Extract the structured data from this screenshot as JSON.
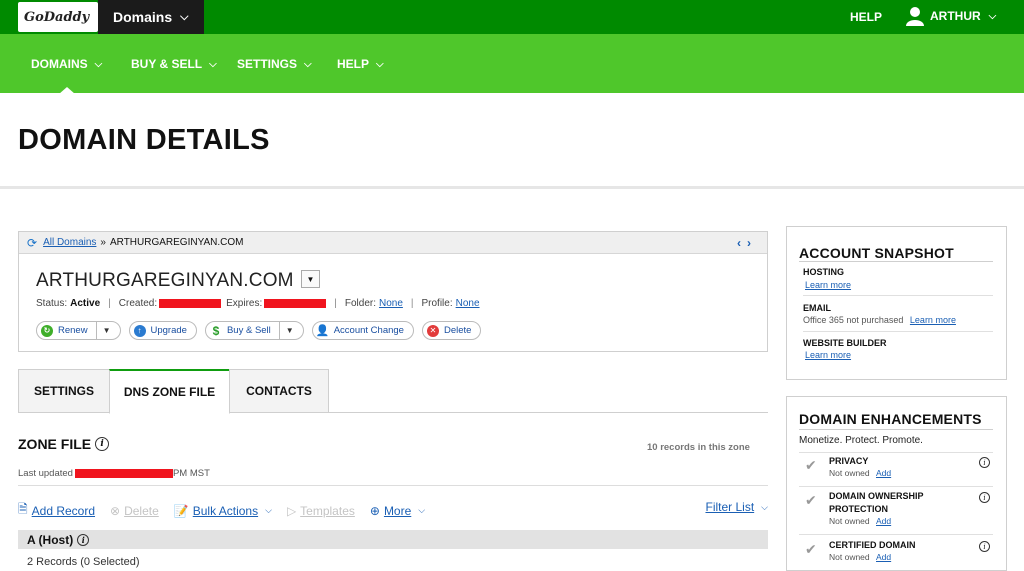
{
  "brand": {
    "logo_text": "GoDaddy",
    "product_switch": "Domains"
  },
  "topbar": {
    "help": "HELP",
    "user": "ARTHUR"
  },
  "nav": {
    "items": [
      {
        "label": "DOMAINS"
      },
      {
        "label": "BUY & SELL"
      },
      {
        "label": "SETTINGS"
      },
      {
        "label": "HELP"
      }
    ]
  },
  "page": {
    "title": "DOMAIN DETAILS"
  },
  "domain_panel": {
    "all_domains": "All Domains",
    "separator": "»",
    "current": "ARTHURGAREGINYAN.COM",
    "name": "ARTHURGAREGINYAN.COM",
    "status_label": "Status:",
    "status_value": "Active",
    "created_label": "Created:",
    "expires_label": "Expires:",
    "folder_label": "Folder:",
    "folder_value": "None",
    "profile_label": "Profile:",
    "profile_value": "None",
    "actions": {
      "renew": "Renew",
      "upgrade": "Upgrade",
      "buy_sell": "Buy & Sell",
      "account_change": "Account Change",
      "delete": "Delete"
    }
  },
  "tabs": [
    {
      "label": "SETTINGS"
    },
    {
      "label": "DNS ZONE FILE"
    },
    {
      "label": "CONTACTS"
    }
  ],
  "zone": {
    "title": "ZONE FILE",
    "count": "10 records in this zone",
    "last_updated_label": "Last updated",
    "last_updated_suffix": "PM MST",
    "toolbar": {
      "add_record": "Add Record",
      "delete": "Delete",
      "bulk_actions": "Bulk Actions",
      "templates": "Templates",
      "more": "More",
      "filter": "Filter List"
    },
    "section": "A (Host)",
    "records": "2 Records (0 Selected)"
  },
  "snapshot": {
    "title": "ACCOUNT SNAPSHOT",
    "hosting_label": "HOSTING",
    "hosting_link": "Learn more",
    "email_label": "EMAIL",
    "email_status": "Office 365 not purchased",
    "email_link": "Learn more",
    "builder_label": "WEBSITE BUILDER",
    "builder_link": "Learn more"
  },
  "enhancements": {
    "title": "DOMAIN ENHANCEMENTS",
    "subtitle": "Monetize. Protect. Promote.",
    "items": [
      {
        "label": "PRIVACY",
        "status": "Not owned",
        "action": "Add"
      },
      {
        "label": "DOMAIN OWNERSHIP PROTECTION",
        "status": "Not owned",
        "action": "Add"
      },
      {
        "label": "CERTIFIED DOMAIN",
        "status": "Not owned",
        "action": "Add"
      }
    ]
  },
  "colors": {
    "top_green": "#008a00",
    "nav_green": "#4fc72b",
    "link_blue": "#1a5fb4",
    "redaction": "#f0141e"
  }
}
